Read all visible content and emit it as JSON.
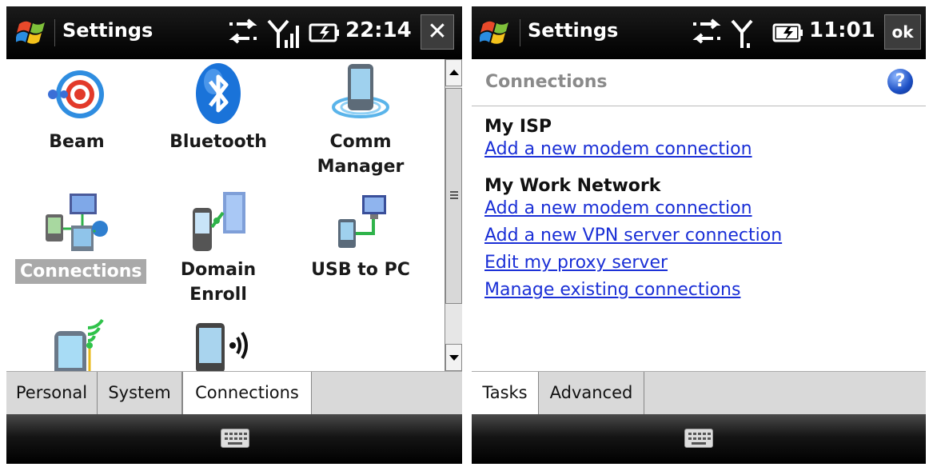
{
  "left": {
    "title": "Settings",
    "clock": "22:14",
    "close_label": "✕",
    "tiles": [
      {
        "label": "Beam",
        "icon": "beam-icon"
      },
      {
        "label": "Bluetooth",
        "icon": "bluetooth-icon"
      },
      {
        "label": "Comm\nManager",
        "icon": "comm-manager-icon"
      },
      {
        "label": "Connections",
        "icon": "connections-icon",
        "selected": true
      },
      {
        "label": "Domain\nEnroll",
        "icon": "domain-enroll-icon"
      },
      {
        "label": "USB to PC",
        "icon": "usb-to-pc-icon"
      },
      {
        "label": "",
        "icon": "wifi-icon"
      },
      {
        "label": "",
        "icon": "wireless-manager-icon"
      }
    ],
    "tabs": [
      "Personal",
      "System",
      "Connections"
    ]
  },
  "right": {
    "title": "Settings",
    "clock": "11:01",
    "ok_label": "ok",
    "header": "Connections",
    "help_label": "?",
    "sections": [
      {
        "title": "My ISP",
        "links": [
          "Add a new modem connection"
        ]
      },
      {
        "title": "My Work Network",
        "links": [
          "Add a new modem connection",
          "Add a new VPN server connection",
          "Edit my proxy server",
          "Manage existing connections"
        ]
      }
    ],
    "tabs": [
      "Tasks",
      "Advanced"
    ]
  },
  "colors": {
    "link": "#1a2fd6",
    "titlebar": "#000000",
    "selected_label_bg": "#a9a9a9"
  }
}
